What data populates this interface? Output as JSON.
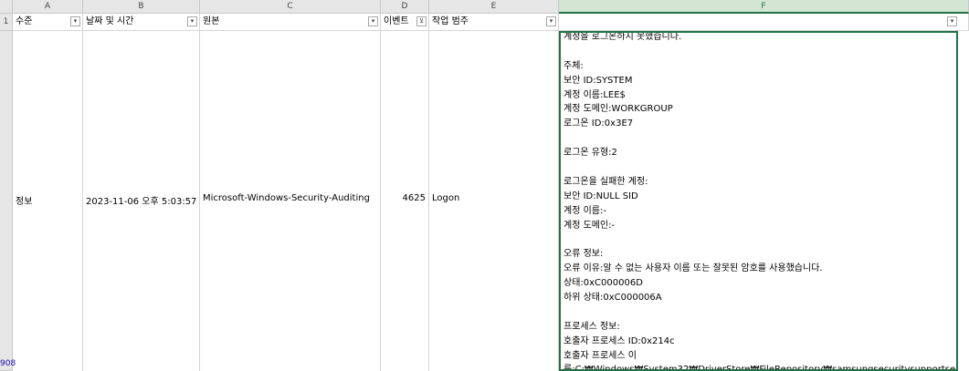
{
  "columns": [
    "A",
    "B",
    "C",
    "D",
    "E",
    "F"
  ],
  "row_numbers": [
    "1",
    "908"
  ],
  "headers": {
    "a": "수준",
    "b": "날짜 및 시간",
    "c": "원본",
    "d": "이벤트",
    "e": "작업 범주",
    "f": ""
  },
  "row": {
    "level": "정보",
    "datetime": "2023-11-06 오후 5:03:57",
    "source": "Microsoft-Windows-Security-Auditing",
    "event_id": "4625",
    "category": "Logon",
    "detail_lines": [
      "계정을 로그온하지 못했습니다.",
      "",
      "주체:",
      "보안 ID:SYSTEM",
      "계정 이름:LEE$",
      "계정 도메인:WORKGROUP",
      "로그온 ID:0x3E7",
      "",
      "로그온 유형:2",
      "",
      "로그온을 실패한 계정:",
      "보안 ID:NULL SID",
      "계정 이름:-",
      "계정 도메인:-",
      "",
      "오류 정보:",
      "오류 이유:알 수 없는 사용자 이름 또는 잘못된 암호를 사용했습니다.",
      "상태:0xC000006D",
      "하위 상태:0xC000006A",
      "",
      "프로세스 정보:",
      "호출자 프로세스 ID:0x214c",
      "호출자 프로세스 이",
      "름:C:₩Windows₩System32₩DriverStore₩FileRepository₩samsungsecuritysupportservicecompon"
    ]
  },
  "colors": {
    "selected_column": "#217346",
    "header_bg": "#e6e6e6",
    "row_number_link": "#1a0dab"
  },
  "icons": {
    "dropdown": "chevron-down-icon",
    "filter_applied": "filter-icon"
  }
}
